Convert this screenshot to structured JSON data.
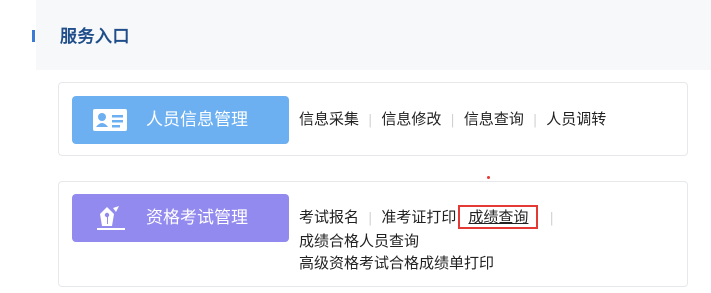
{
  "header": {
    "title": "服务入口"
  },
  "colors": {
    "accent": "#3a7bd5",
    "module1": "#6db0f2",
    "module2": "#938af0",
    "highlight": "#e53935"
  },
  "modules": [
    {
      "label": "人员信息管理",
      "icon": "id-card-icon",
      "links": [
        "信息采集",
        "信息修改",
        "信息查询",
        "人员调转"
      ]
    },
    {
      "label": "资格考试管理",
      "icon": "pen-nib-icon",
      "links": [
        "考试报名",
        "准考证打印",
        "成绩查询",
        "成绩合格人员查询",
        "高级资格考试合格成绩单打印"
      ],
      "highlighted_link": "成绩查询"
    }
  ]
}
